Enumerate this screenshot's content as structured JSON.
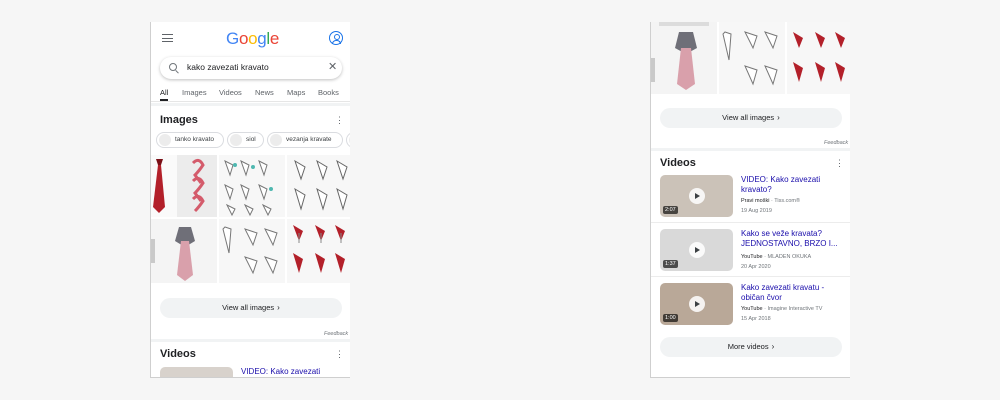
{
  "header": {
    "logo": [
      "G",
      "o",
      "o",
      "g",
      "l",
      "e"
    ],
    "logo_colors": [
      "#4285f4",
      "#ea4335",
      "#fbbc05",
      "#4285f4",
      "#34a853",
      "#ea4335"
    ]
  },
  "search": {
    "query": "kako zavezati kravato"
  },
  "tabs": [
    "All",
    "Images",
    "Videos",
    "News",
    "Maps",
    "Books"
  ],
  "images_section": {
    "title": "Images",
    "chips": [
      "tanko kravato",
      "siol",
      "vezanja kravate"
    ],
    "view_all": "View all images",
    "feedback": "Feedback"
  },
  "videos_section": {
    "title": "Videos",
    "items": [
      {
        "title": "VIDEO: Kako zavezati kravato?",
        "source": "Pravi moški",
        "site": "Tiss.com®",
        "date": "19 Aug 2019",
        "duration": "2:07"
      },
      {
        "title": "Kako se veže kravata? JEDNOSTAVNO, BRZO I...",
        "source": "YouTube",
        "site": "MLADEN OKUKA",
        "date": "20 Apr 2020",
        "duration": "1:37"
      },
      {
        "title": "Kako zavezati kravatu - običan čvor",
        "source": "YouTube",
        "site": "Imagine Interactive TV",
        "date": "15 Apr 2018",
        "duration": "1:00"
      }
    ],
    "more_videos": "More videos"
  },
  "colors": {
    "accent": "#1a73e8",
    "link": "#1a0dab",
    "tie_red": "#b3202a"
  }
}
